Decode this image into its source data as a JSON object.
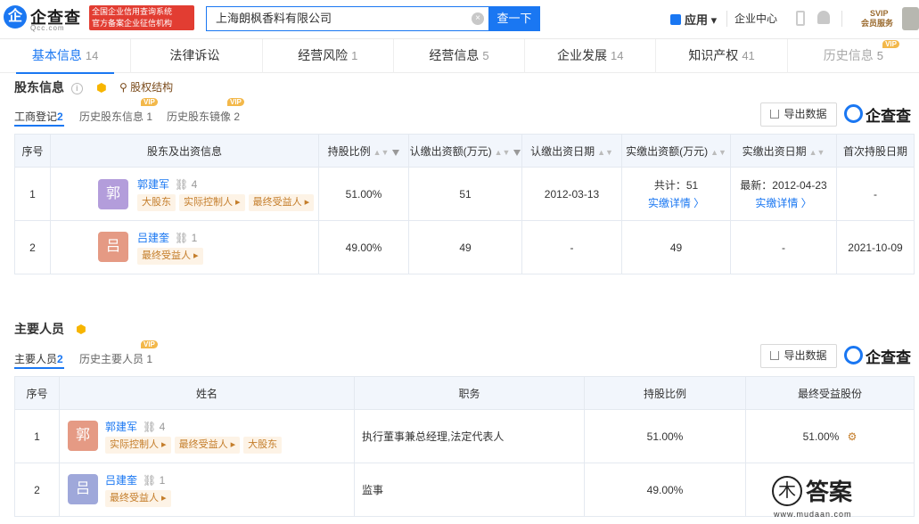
{
  "header": {
    "logo_mark": "企",
    "logo_name": "企查查",
    "logo_domain": "Qcc.com",
    "cert_line1": "全国企业信用查询系统",
    "cert_line2": "官方备案企业征信机构",
    "search_value": "上海朗枫香料有限公司",
    "search_button": "查一下",
    "app_label": "应用",
    "enterprise_center": "企业中心",
    "svip_line1": "SVIP",
    "svip_line2": "会员服务"
  },
  "tabs": [
    {
      "label": "基本信息",
      "count": "14"
    },
    {
      "label": "法律诉讼",
      "count": ""
    },
    {
      "label": "经营风险",
      "count": "1"
    },
    {
      "label": "经营信息",
      "count": "5"
    },
    {
      "label": "企业发展",
      "count": "14"
    },
    {
      "label": "知识产权",
      "count": "41"
    },
    {
      "label": "历史信息",
      "count": "5",
      "badge": "VIP"
    }
  ],
  "shareholders": {
    "title": "股东信息",
    "info_glyph": "i",
    "structure_link": "股权结构",
    "subtabs": [
      {
        "label": "工商登记",
        "count": "2"
      },
      {
        "label": "历史股东信息",
        "count": "1",
        "badge": "VIP"
      },
      {
        "label": "历史股东镜像",
        "count": "2",
        "badge": "VIP"
      }
    ],
    "export_label": "导出数据",
    "brand": "企查查",
    "columns": [
      "序号",
      "股东及出资信息",
      "持股比例",
      "认缴出资额(万元)",
      "认缴出资日期",
      "实缴出资额(万元)",
      "实缴出资日期",
      "首次持股日期"
    ],
    "rows": [
      {
        "no": "1",
        "avatar": "郭",
        "name": "郭建军",
        "related": "4",
        "tags": [
          "大股东",
          "实际控制人 ▸",
          "最终受益人 ▸"
        ],
        "ratio": "51.00%",
        "subscribed": "51",
        "sub_date": "2012-03-13",
        "paid": "共计：51",
        "paid_link": "实缴详情 〉",
        "paid_date": "最新：2012-04-23",
        "paid_date_link": "实缴详情 〉",
        "first_date": "-"
      },
      {
        "no": "2",
        "avatar": "吕",
        "name": "吕建奎",
        "related": "1",
        "tags": [
          "最终受益人 ▸"
        ],
        "ratio": "49.00%",
        "subscribed": "49",
        "sub_date": "-",
        "paid": "49",
        "paid_link": "",
        "paid_date": "-",
        "paid_date_link": "",
        "first_date": "2021-10-09"
      }
    ]
  },
  "personnel": {
    "title": "主要人员",
    "subtabs": [
      {
        "label": "主要人员",
        "count": "2"
      },
      {
        "label": "历史主要人员",
        "count": "1",
        "badge": "VIP"
      }
    ],
    "export_label": "导出数据",
    "brand": "企查查",
    "columns": [
      "序号",
      "姓名",
      "职务",
      "持股比例",
      "最终受益股份"
    ],
    "rows": [
      {
        "no": "1",
        "avatar": "郭",
        "name": "郭建军",
        "related": "4",
        "tags": [
          "实际控制人 ▸",
          "最终受益人 ▸",
          "大股东"
        ],
        "position": "执行董事兼总经理,法定代表人",
        "ratio": "51.00%",
        "benefit": "51.00%"
      },
      {
        "no": "2",
        "avatar": "吕",
        "name": "吕建奎",
        "related": "1",
        "tags": [
          "最终受益人 ▸"
        ],
        "position": "监事",
        "ratio": "49.00%",
        "benefit": ""
      }
    ]
  },
  "watermark": {
    "glyph": "木",
    "text": "答案",
    "url": "www.mudaan.com"
  },
  "colors": {
    "accent": "#1a77f2",
    "avatar_guo": "#b39ddb",
    "avatar_lv": "#e59a84",
    "avatar_guo2": "#e59a84",
    "avatar_lv2": "#9fa8da",
    "tag_bg": "#fdf3e6",
    "tag_fg": "#c47d2a"
  },
  "icons": [
    "search-clear-icon",
    "app-grid-icon",
    "phone-icon",
    "bell-icon",
    "info-icon",
    "hex-badge-icon",
    "equity-structure-icon",
    "download-icon",
    "sort-icon",
    "filter-icon",
    "relation-icon"
  ]
}
